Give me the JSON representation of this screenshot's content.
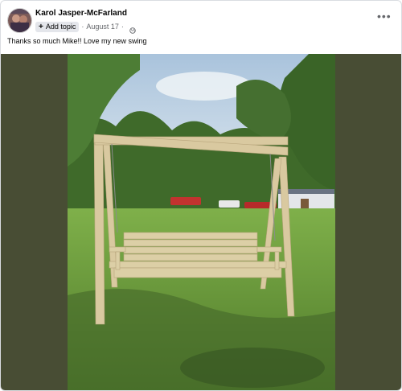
{
  "post": {
    "author_name": "Karol Jasper-McFarland",
    "add_topic_label": "Add topic",
    "separator": "·",
    "date": "August 17",
    "separator2": "·",
    "more_label": "•••",
    "caption": "Thanks so much Mike!! Love my new swing"
  },
  "icons": {
    "add": "plus-icon",
    "privacy": "globe-icon",
    "more": "more-options-icon"
  },
  "colors": {
    "photo_background": "#484d34",
    "chip_background": "#e4e6eb",
    "secondary_text": "#65676b"
  }
}
